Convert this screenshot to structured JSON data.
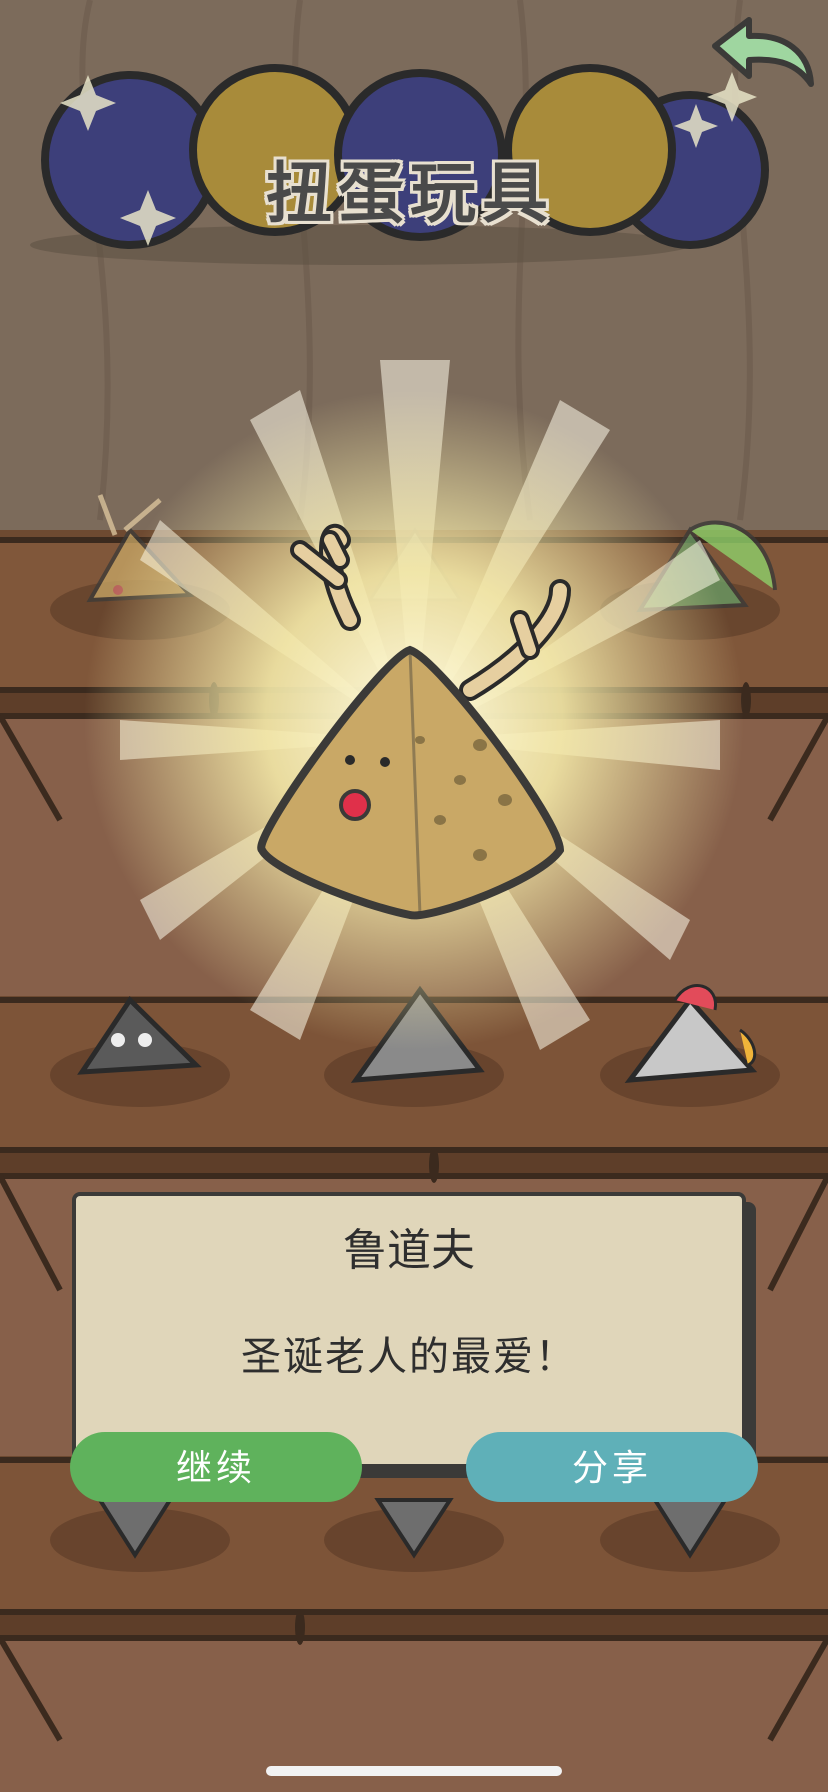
{
  "header": {
    "title": "扭蛋玩具",
    "back_icon": "back-arrow-icon"
  },
  "reveal": {
    "character_icon": "reindeer-pyramid-icon"
  },
  "result_card": {
    "name": "鲁道夫",
    "description": "圣诞老人的最爱！"
  },
  "actions": {
    "continue_label": "继续",
    "share_label": "分享"
  },
  "colors": {
    "continue": "#5fb25c",
    "share": "#5fb0b8",
    "card": "#e0d6ba",
    "shelf": "#7a4f33"
  }
}
